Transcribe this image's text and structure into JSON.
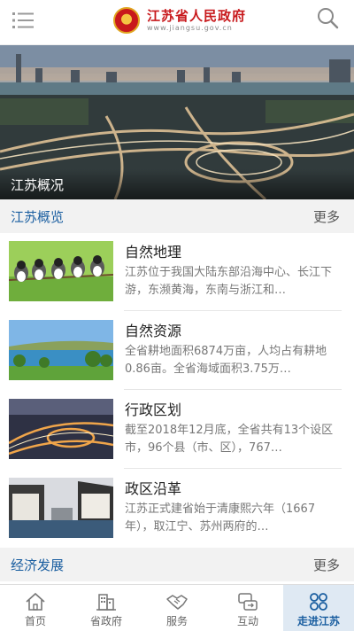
{
  "header": {
    "title": "江苏省人民政府",
    "url": "www.jiangsu.gov.cn"
  },
  "banner": {
    "caption": "江苏概况"
  },
  "section1": {
    "title": "江苏概览",
    "more": "更多"
  },
  "items": [
    {
      "title": "自然地理",
      "desc": "江苏位于我国大陆东部沿海中心、长江下游，东濒黄海，东南与浙江和…"
    },
    {
      "title": "自然资源",
      "desc": "全省耕地面积6874万亩，人均占有耕地0.86亩。全省海域面积3.75万…"
    },
    {
      "title": "行政区划",
      "desc": "截至2018年12月底，全省共有13个设区市，96个县（市、区），767…"
    },
    {
      "title": "政区沿革",
      "desc": "江苏正式建省始于清康熙六年（1667年），取江宁、苏州两府的…"
    }
  ],
  "section2": {
    "title": "经济发展",
    "more": "更多"
  },
  "tabs": [
    {
      "label": "首页",
      "icon": "home-icon"
    },
    {
      "label": "省政府",
      "icon": "building-icon"
    },
    {
      "label": "服务",
      "icon": "handshake-icon"
    },
    {
      "label": "互动",
      "icon": "exchange-icon"
    },
    {
      "label": "走进江苏",
      "icon": "grid-icon",
      "active": true
    }
  ],
  "colors": {
    "brand_red": "#c8191c",
    "accent_blue": "#1a5ea0"
  }
}
